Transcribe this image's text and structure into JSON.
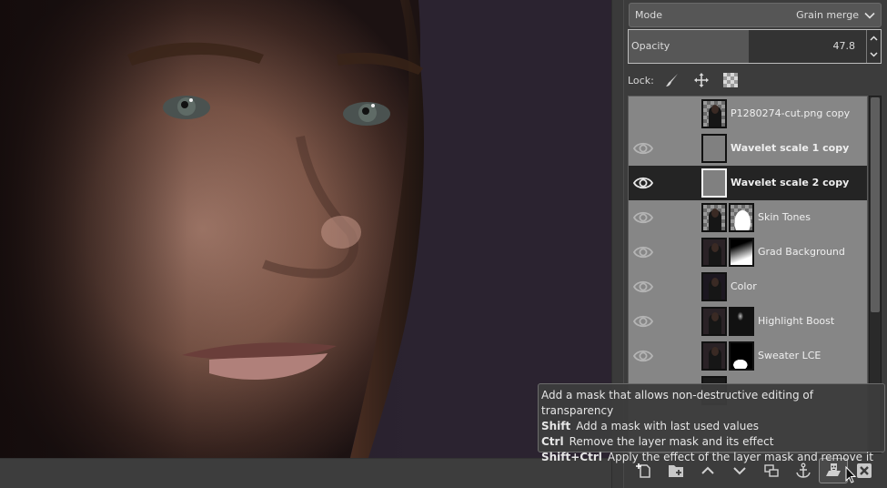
{
  "canvas": {
    "image_description": "close-up portrait of a woman's face, dark purple background"
  },
  "layers_dock": {
    "mode": {
      "label": "Mode",
      "value": "Grain merge"
    },
    "opacity": {
      "label": "Opacity",
      "value": "47.8",
      "percent": 47.8
    },
    "lock": {
      "label": "Lock:",
      "icons": [
        "paintbrush-icon",
        "move-arrows-icon",
        "checkerboard-alpha-icon"
      ]
    },
    "layers": [
      {
        "name": "P1280274-cut.png copy",
        "visible": false,
        "bold": false,
        "selected": false,
        "thumb": "checker-photo",
        "mask": null
      },
      {
        "name": "Wavelet scale 1 copy",
        "visible": true,
        "bold": true,
        "selected": false,
        "thumb": "gray",
        "mask": null
      },
      {
        "name": "Wavelet scale 2 copy",
        "visible": true,
        "bold": true,
        "selected": true,
        "thumb": "gray",
        "mask": null
      },
      {
        "name": "Skin Tones",
        "visible": true,
        "bold": false,
        "selected": false,
        "thumb": "checker-photo",
        "mask": "silhouette-white"
      },
      {
        "name": "Grad Background",
        "visible": true,
        "bold": false,
        "selected": false,
        "thumb": "photo",
        "mask": "gradient"
      },
      {
        "name": "Color",
        "visible": true,
        "bold": false,
        "selected": false,
        "thumb": "photo-dark",
        "mask": null
      },
      {
        "name": "Highlight Boost",
        "visible": true,
        "bold": false,
        "selected": false,
        "thumb": "photo",
        "mask": "highlight"
      },
      {
        "name": "Sweater LCE",
        "visible": true,
        "bold": false,
        "selected": false,
        "thumb": "photo",
        "mask": "sweater"
      }
    ],
    "buttons": [
      {
        "name": "new-layer-button",
        "icon": "new-layer-icon"
      },
      {
        "name": "new-layer-group-button",
        "icon": "new-group-icon"
      },
      {
        "name": "raise-layer-button",
        "icon": "chevron-up-icon"
      },
      {
        "name": "lower-layer-button",
        "icon": "chevron-down-icon"
      },
      {
        "name": "duplicate-layer-button",
        "icon": "duplicate-icon"
      },
      {
        "name": "anchor-layer-button",
        "icon": "anchor-icon"
      },
      {
        "name": "add-mask-button",
        "icon": "mask-icon"
      },
      {
        "name": "delete-layer-button",
        "icon": "delete-icon"
      }
    ]
  },
  "tooltip": {
    "line1": "Add a mask that allows non-destructive editing of transparency",
    "line2_key": "Shift",
    "line2_text": "Add a mask with last used values",
    "line3_key": "Ctrl",
    "line3_text": "Remove the layer mask and its effect",
    "line4_key": "Shift+Ctrl",
    "line4_text": "Apply the effect of the layer mask and remove it"
  },
  "colors": {
    "panel_bg": "#3c3c3c",
    "list_bg": "#868686",
    "selected_row": "#242424",
    "canvas_bg": "#2b2330"
  }
}
